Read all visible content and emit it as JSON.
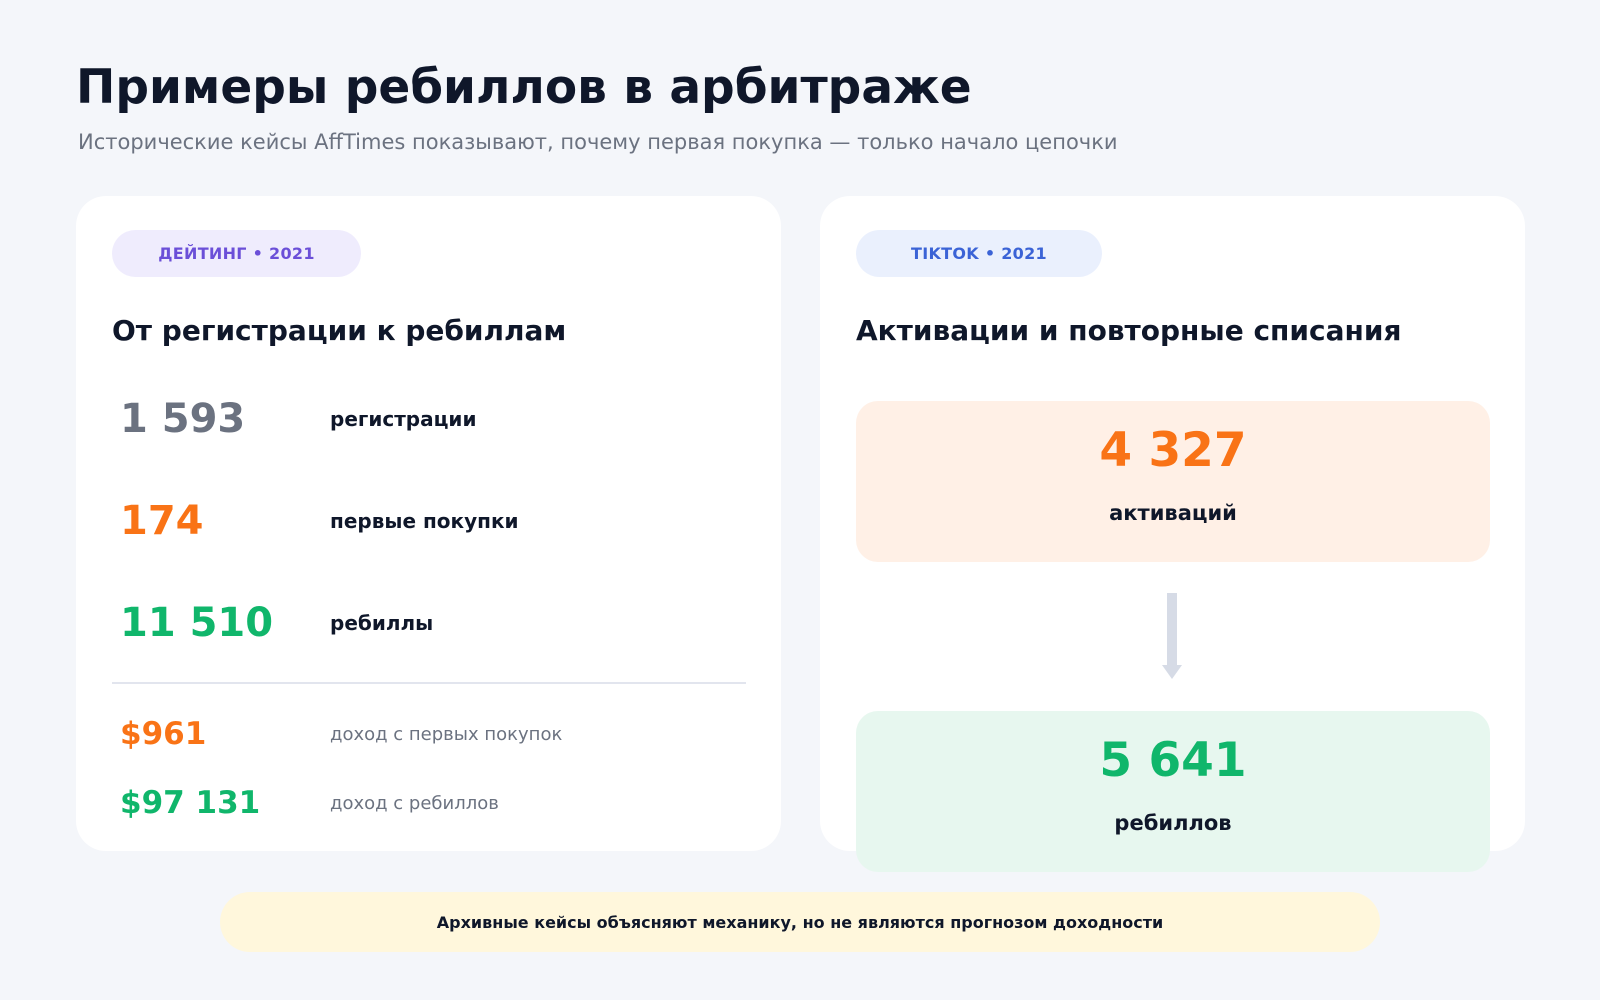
{
  "header": {
    "title": "Примеры ребиллов в арбитраже",
    "subtitle": "Исторические кейсы AffTimes показывают, почему первая покупка — только начало цепочки"
  },
  "dating_case": {
    "tag": "ДЕЙТИНГ • 2021",
    "title": "От регистрации к ребиллам",
    "stats": [
      {
        "value": "1 593",
        "label": "регистрации"
      },
      {
        "value": "174",
        "label": "первые покупки"
      },
      {
        "value": "11 510",
        "label": "ребиллы"
      }
    ],
    "revenue": [
      {
        "value": "$961",
        "label": "доход с первых покупок"
      },
      {
        "value": "$97 131",
        "label": "доход с ребиллов"
      }
    ]
  },
  "tiktok_case": {
    "tag": "TIKTOK • 2021",
    "title": "Активации и повторные списания",
    "activations": {
      "value": "4 327",
      "label": "активаций"
    },
    "rebills": {
      "value": "5 641",
      "label": "ребиллов"
    }
  },
  "footer": {
    "note": "Архивные кейсы объясняют механику, но не являются прогнозом доходности"
  },
  "colors": {
    "background": "#f4f6fa",
    "accent_orange": "#f97316",
    "accent_green": "#10b66b",
    "muted_gray": "#6b7280",
    "dating_tag": "#6b4fd8",
    "tiktok_tag": "#3b63d6"
  }
}
